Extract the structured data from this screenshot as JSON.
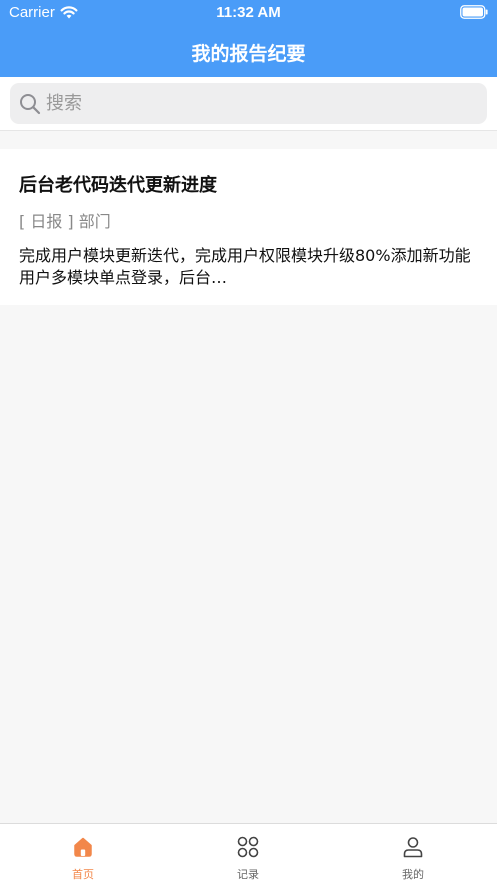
{
  "status_bar": {
    "carrier": "Carrier",
    "time": "11:32 AM"
  },
  "nav": {
    "title": "我的报告纪要"
  },
  "search": {
    "placeholder": "搜索"
  },
  "reports": [
    {
      "title": "后台老代码迭代更新进度",
      "meta": "[ 日报 ] 部门",
      "summary": "完成用户模块更新迭代，完成用户权限模块升级80%添加新功能用户多模块单点登录，后台…"
    }
  ],
  "tabs": [
    {
      "label": "首页",
      "icon": "home-icon",
      "active": true
    },
    {
      "label": "记录",
      "icon": "grid-icon",
      "active": false
    },
    {
      "label": "我的",
      "icon": "user-icon",
      "active": false
    }
  ],
  "colors": {
    "header": "#4a9cf8",
    "active_tab": "#f2874a",
    "inactive_tab": "#666666"
  }
}
